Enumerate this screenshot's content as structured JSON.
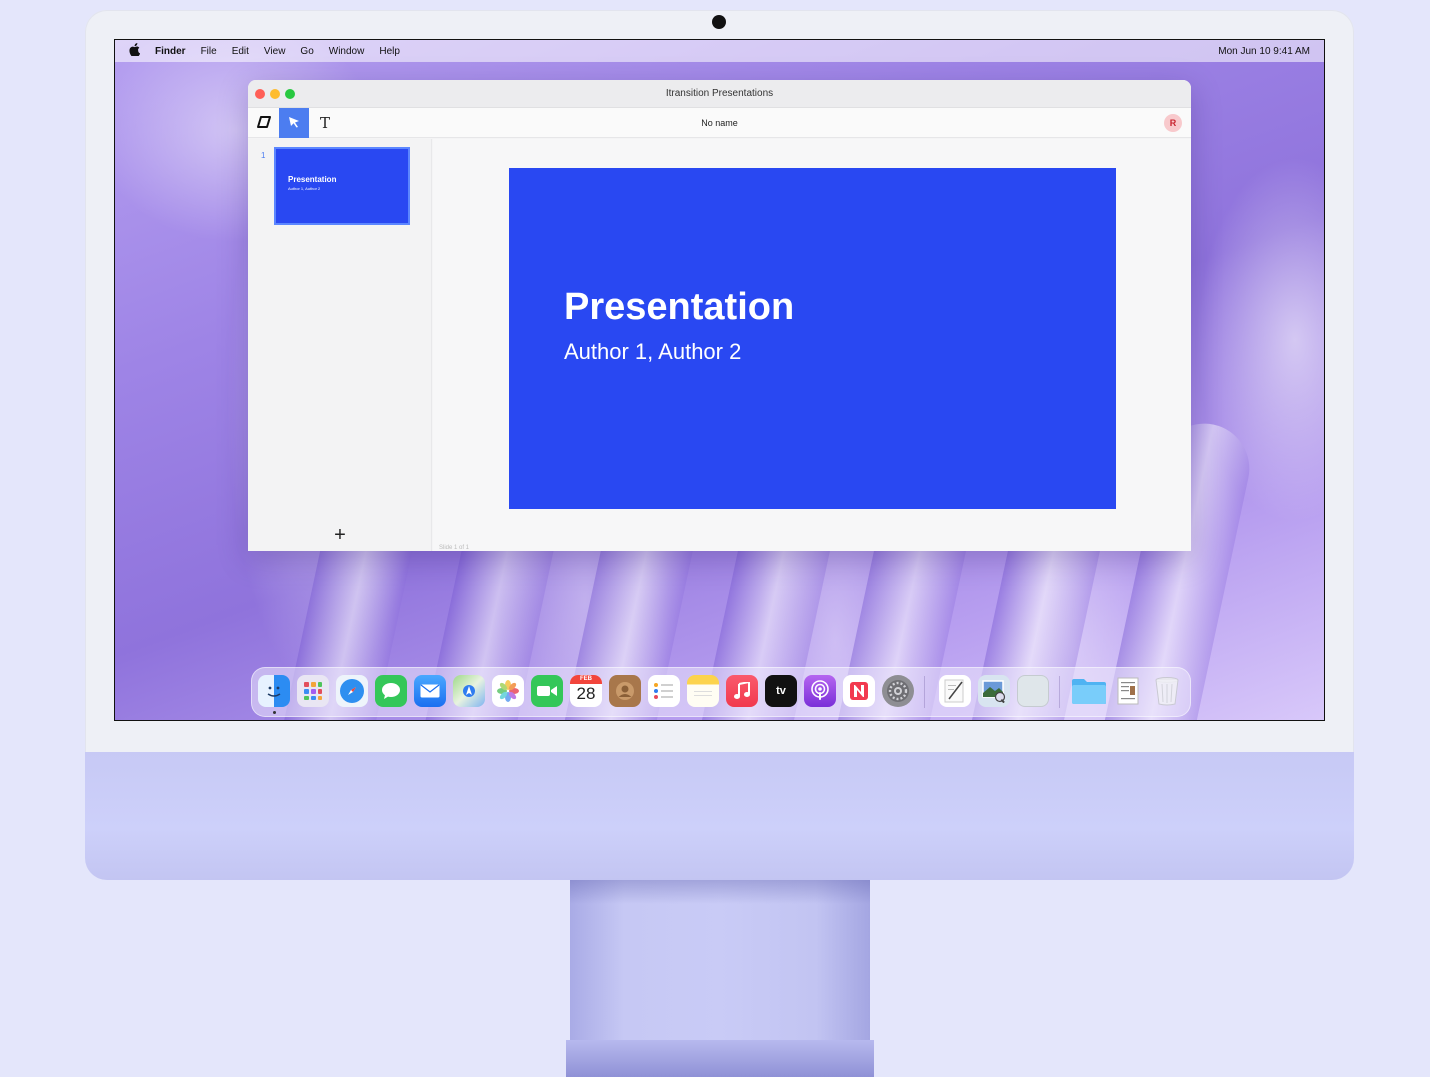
{
  "menubar": {
    "apple": "",
    "items": [
      "Finder",
      "File",
      "Edit",
      "View",
      "Go",
      "Window",
      "Help"
    ],
    "clock": "Mon Jun 10  9:41 AM"
  },
  "window": {
    "title": "Itransition Presentations",
    "doc_name": "No name",
    "avatar_initial": "R",
    "tools": {
      "shape": "◇",
      "select": "➤",
      "text": "T"
    }
  },
  "sidebar": {
    "slides": [
      {
        "number": "1",
        "title": "Presentation",
        "subtitle": "Author 1, Author 2"
      }
    ],
    "add_symbol": "+"
  },
  "slide": {
    "title": "Presentation",
    "subtitle": "Author 1, Author 2",
    "count_label": "Slide 1 of 1",
    "background": "#2948f2"
  },
  "dock": {
    "calendar_month": "FEB",
    "calendar_day": "28",
    "tv_label": "tv",
    "apps": [
      "finder",
      "launchpad",
      "safari",
      "messages",
      "mail",
      "maps",
      "photos",
      "facetime",
      "calendar",
      "contacts",
      "reminders",
      "notes",
      "music",
      "tv",
      "podcasts",
      "news",
      "system-settings",
      "textedit",
      "preview",
      "blank-app",
      "folder",
      "document",
      "trash"
    ]
  }
}
